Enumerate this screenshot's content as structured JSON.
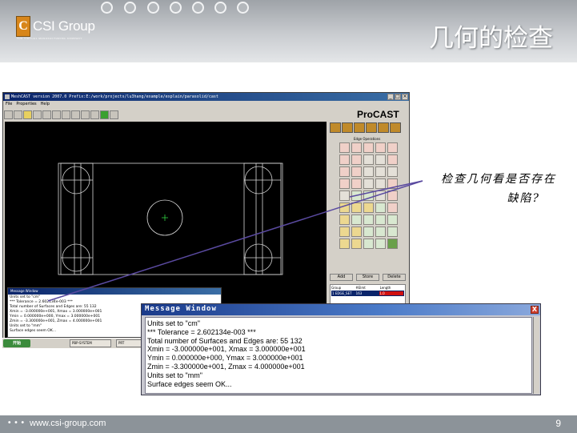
{
  "slide": {
    "logo_text": "CSI Group",
    "logo_tagline": "THE VIRTUAL MANUFACTURING COMPANY",
    "title": "几何的检查",
    "footer_url": "www.csi-group.com",
    "page_number": "9",
    "callout_line1": "检查几何看是否存在",
    "callout_line2": "缺陷?"
  },
  "app": {
    "title": "MeshCAST version 2007.0   Prefix:E:/work/projects/lu3hang/example/explain/parasolid/cast",
    "menu": [
      "File",
      "Properties",
      "Help"
    ],
    "procast_logo": "ProCAST",
    "edge_ops_label": "Edge Operations",
    "panel_buttons": [
      "Add",
      "Store",
      "Delete"
    ],
    "group_table": {
      "headers": [
        "Group",
        "#Elmt",
        "Length"
      ],
      "row": [
        "1  EDGE_SET",
        "163",
        "1.0"
      ]
    }
  },
  "small_message": {
    "title": "Message Window",
    "lines": [
      "Units set to \"cm\"",
      "*** Tolerance = 2.602134e-003 ***",
      "Total number of Surfaces and Edges are: 55 132",
      "Xmin = -3.000000e+001,  Xmax = 3.000000e+001",
      "Ymin = 0.000000e+000,  Ymax = 3.000000e+001",
      "Zmin = -3.300000e+001,  Zmax = 4.000000e+001",
      "Units set to \"mm\"",
      "Surface edges seem OK..."
    ]
  },
  "taskbar": {
    "start_label": "开始",
    "tasks": [
      "PBP-SYSTEM",
      "PRT"
    ]
  },
  "message_window": {
    "title": "Message Window",
    "close_label": "X",
    "lines": [
      "Units set to \"cm\"",
      " *** Tolerance = 2.602134e-003 ***",
      "Total number of Surfaces and Edges are: 55 132",
      "Xmin = -3.000000e+001,  Xmax = 3.000000e+001",
      "Ymin = 0.000000e+000,  Ymax = 3.000000e+001",
      "Zmin = -3.300000e+001,  Zmax = 4.000000e+001",
      "Units set to \"mm\"",
      "Surface edges seem OK..."
    ]
  }
}
